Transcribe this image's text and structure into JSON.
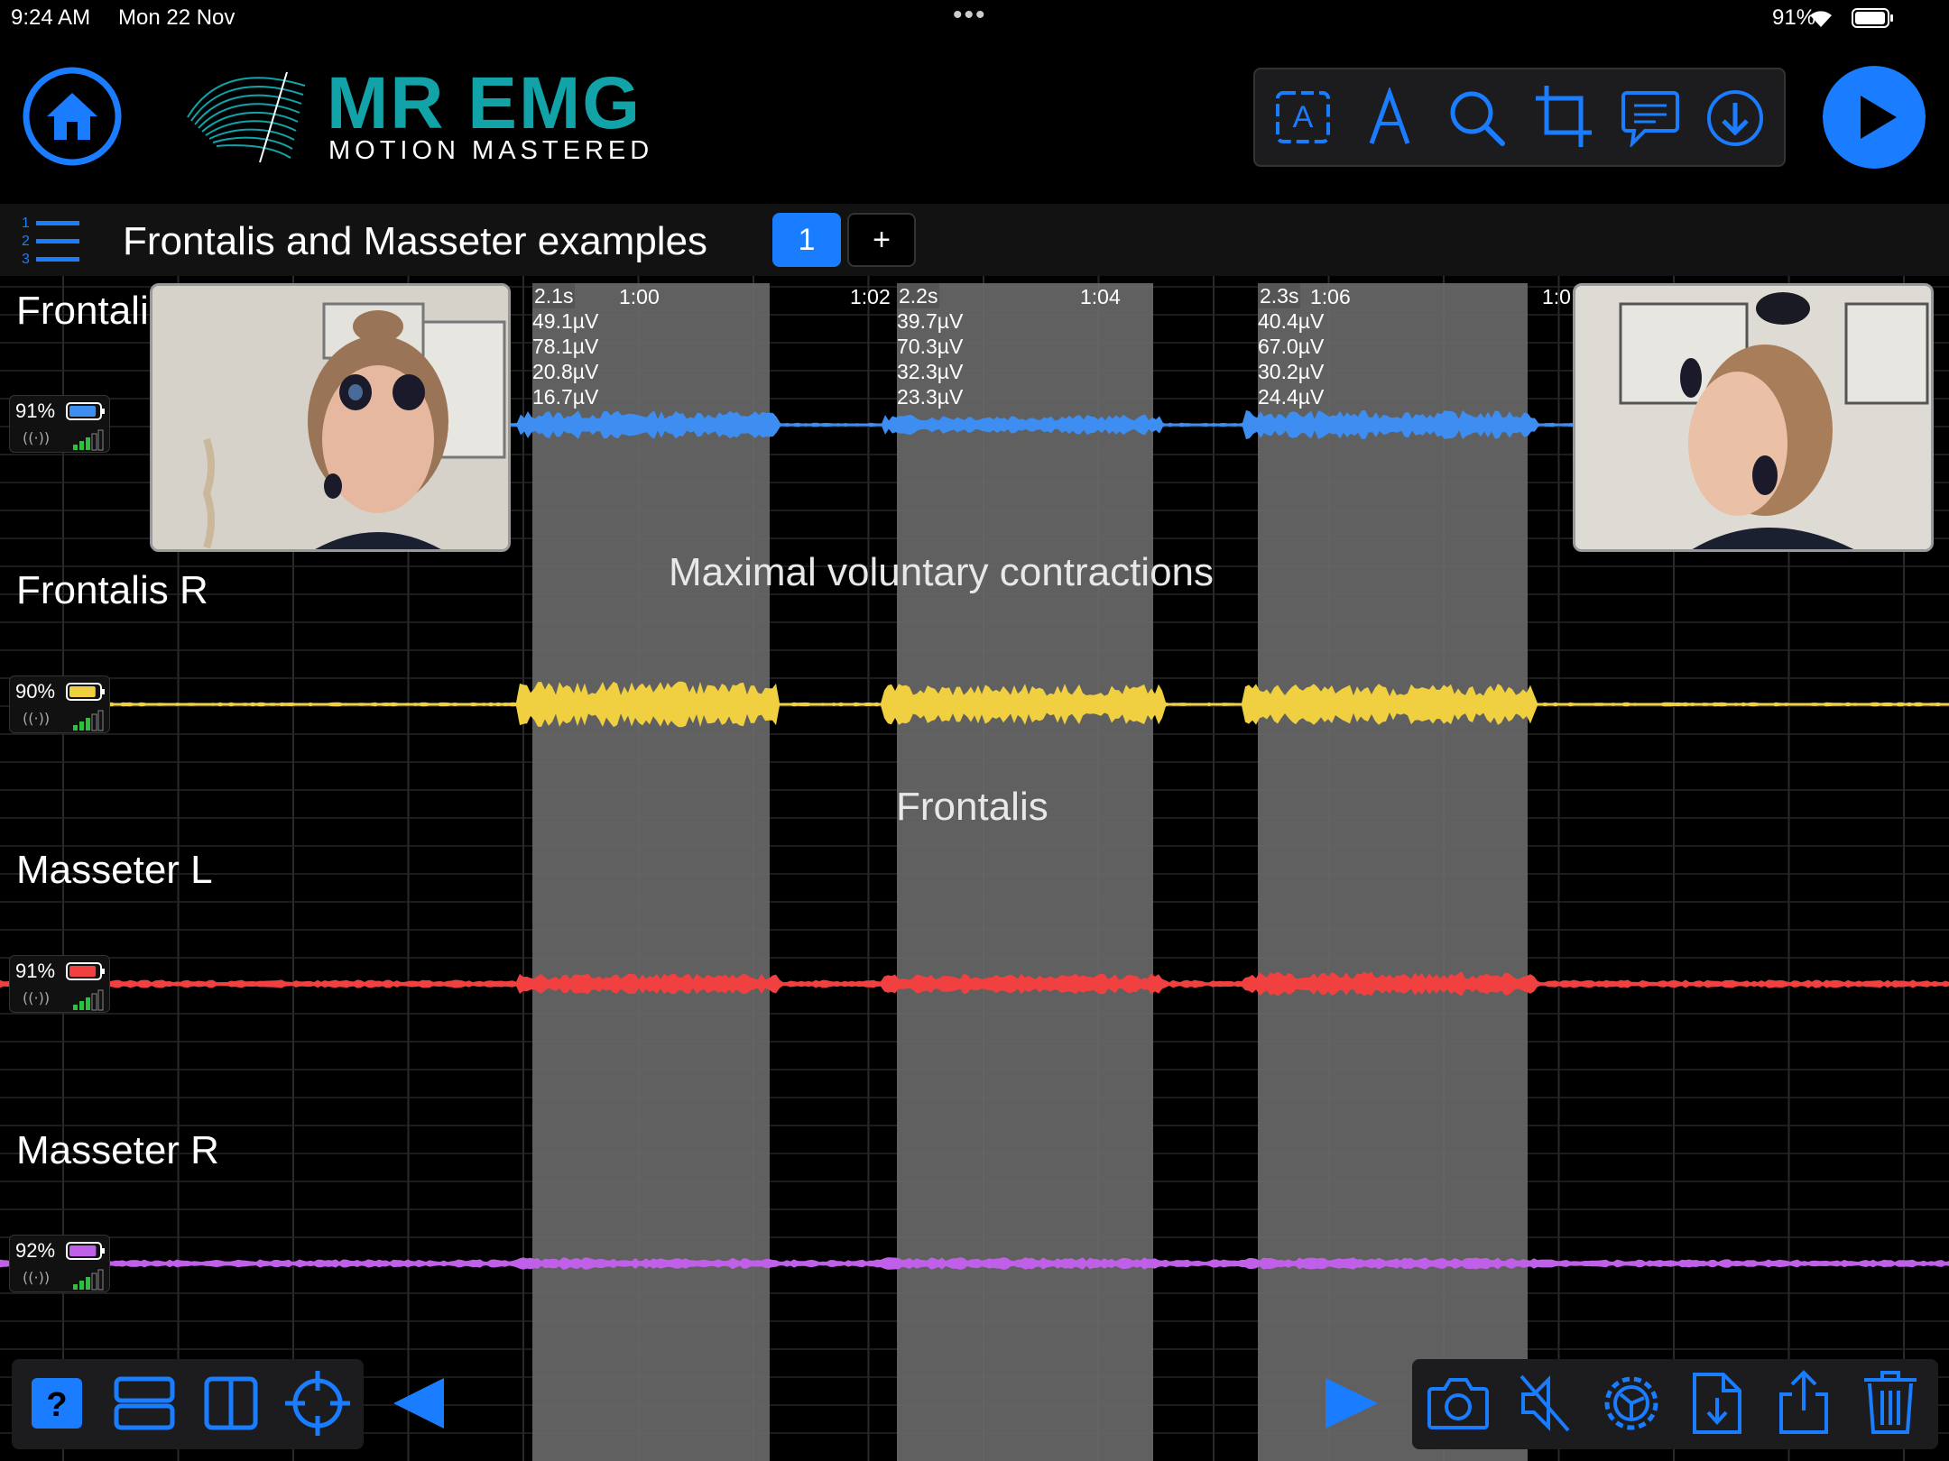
{
  "status": {
    "time": "9:24 AM",
    "date": "Mon 22 Nov",
    "dots": "•••",
    "battery_pct": "91%"
  },
  "logo": {
    "title": "MR EMG",
    "subtitle": "MOTION MASTERED",
    "color": "#11a3a8"
  },
  "colors": {
    "accent": "#1a7cff",
    "frontalis_l": "#3d8ef0",
    "frontalis_r": "#f0d040",
    "masseter_l": "#f04040",
    "masseter_r": "#c060e8"
  },
  "toolbar": {
    "icons": [
      "text-box-icon",
      "pen-icon",
      "search-icon",
      "crop-icon",
      "comment-icon",
      "download-icon"
    ]
  },
  "session": {
    "title": "Frontalis and Masseter examples",
    "page_tab": "1",
    "add_tab": "+"
  },
  "timeline": {
    "labels": [
      "1:00",
      "1:02",
      "1:04",
      "1:06",
      "1:0"
    ]
  },
  "channels": [
    {
      "name": "Frontalis L",
      "battery": "91%",
      "battery_level": 0.91
    },
    {
      "name": "Frontalis R",
      "battery": "90%",
      "battery_level": 0.9
    },
    {
      "name": "Masseter L",
      "battery": "91%",
      "battery_level": 0.91
    },
    {
      "name": "Masseter R",
      "battery": "92%",
      "battery_level": 0.92
    }
  ],
  "segments": [
    {
      "duration": "2.1s",
      "values": [
        "49.1µV",
        "78.1µV",
        "20.8µV",
        "16.7µV"
      ]
    },
    {
      "duration": "2.2s",
      "values": [
        "39.7µV",
        "70.3µV",
        "32.3µV",
        "23.3µV"
      ]
    },
    {
      "duration": "2.3s",
      "values": [
        "40.4µV",
        "67.0µV",
        "30.2µV",
        "24.4µV"
      ]
    }
  ],
  "annotations": {
    "main": "Maximal voluntary contractions",
    "secondary": "Frontalis"
  },
  "bottom": {
    "left_icons": [
      "help-icon",
      "stacked-layout-icon",
      "split-layout-icon",
      "target-icon"
    ],
    "right_icons": [
      "camera-icon",
      "mute-icon",
      "settings-gear-icon",
      "export-file-icon",
      "share-icon",
      "trash-icon"
    ]
  }
}
